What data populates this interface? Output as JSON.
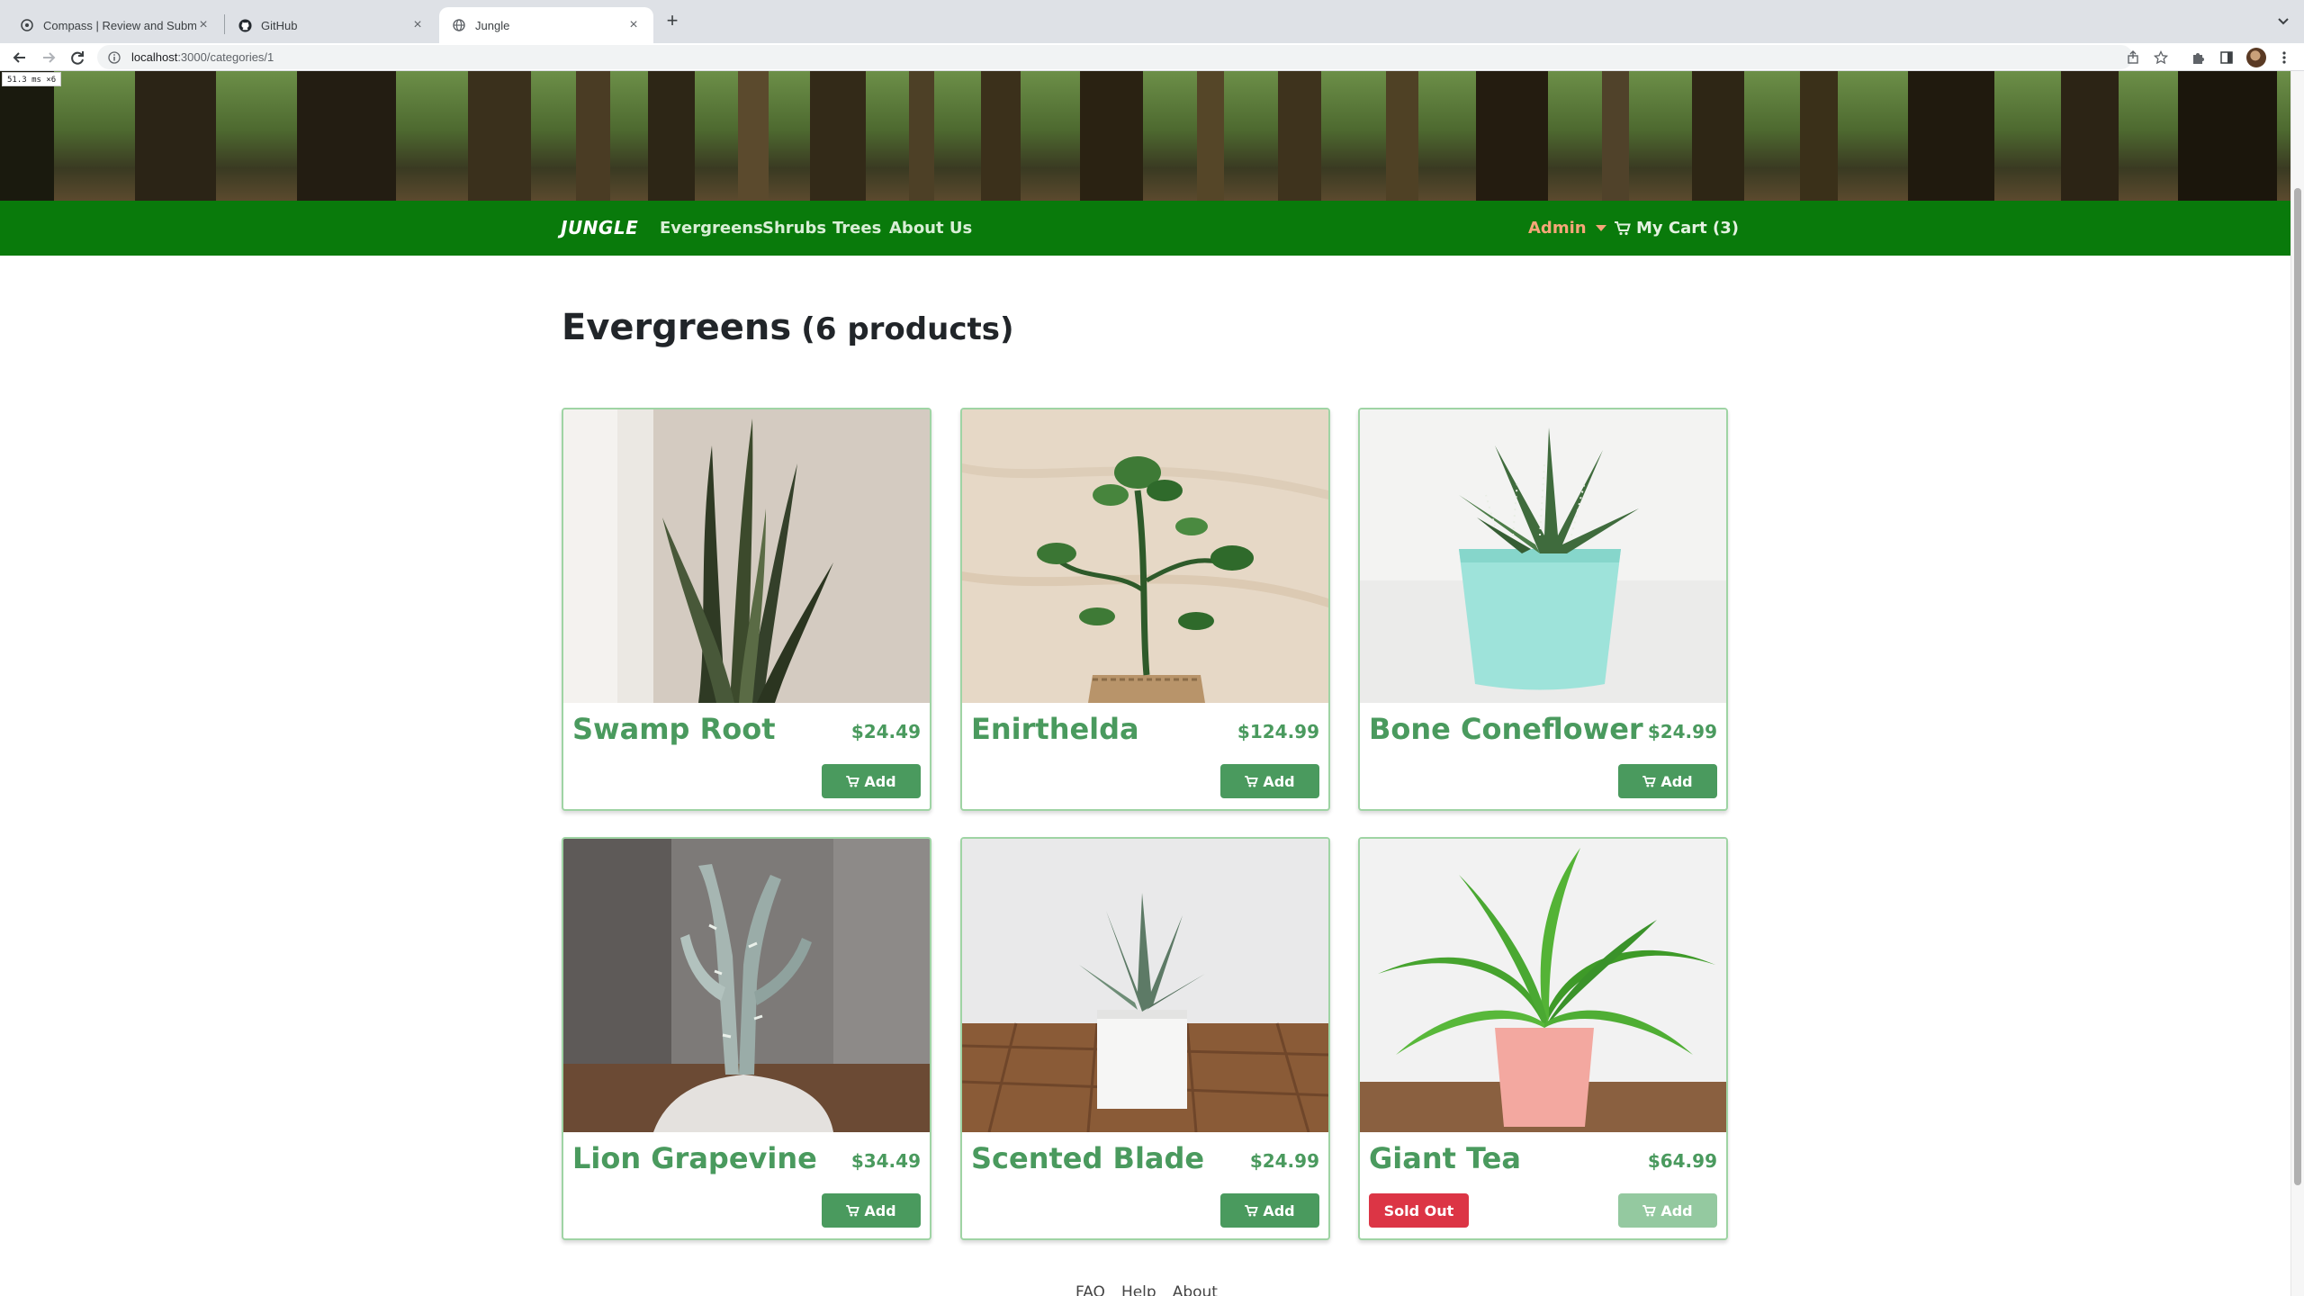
{
  "browser": {
    "tabs": [
      {
        "title": "Compass | Review and Submit",
        "icon": "compass-icon",
        "active": false
      },
      {
        "title": "GitHub",
        "icon": "github-icon",
        "active": false
      },
      {
        "title": "Jungle",
        "icon": "globe-icon",
        "active": true
      }
    ],
    "url_host": "localhost",
    "url_path": ":3000/categories/1",
    "perf_badge": "51.3 ms ×6"
  },
  "navbar": {
    "brand": "JUNGLE",
    "links": [
      "Evergreens",
      "Shrubs",
      "Trees",
      "About Us"
    ],
    "admin_label": "Admin",
    "cart_label": "My Cart (3)"
  },
  "page": {
    "title": "Evergreens",
    "count": "(6 products)"
  },
  "products": [
    {
      "name": "Swamp Root",
      "price": "$24.49",
      "add_label": "Add",
      "sold_out": false
    },
    {
      "name": "Enirthelda",
      "price": "$124.99",
      "add_label": "Add",
      "sold_out": false
    },
    {
      "name": "Bone Coneflower",
      "price": "$24.99",
      "add_label": "Add",
      "sold_out": false
    },
    {
      "name": "Lion Grapevine",
      "price": "$34.49",
      "add_label": "Add",
      "sold_out": false
    },
    {
      "name": "Scented Blade",
      "price": "$24.99",
      "add_label": "Add",
      "sold_out": false
    },
    {
      "name": "Giant Tea",
      "price": "$64.99",
      "add_label": "Add",
      "sold_out": true,
      "sold_out_label": "Sold Out"
    }
  ],
  "footer": {
    "links": [
      "FAQ",
      "Help",
      "About"
    ]
  },
  "colors": {
    "navbar": "#097a0b",
    "product_text": "#4a9a5e",
    "sold_out": "#dc3545",
    "admin": "#f6a678"
  }
}
